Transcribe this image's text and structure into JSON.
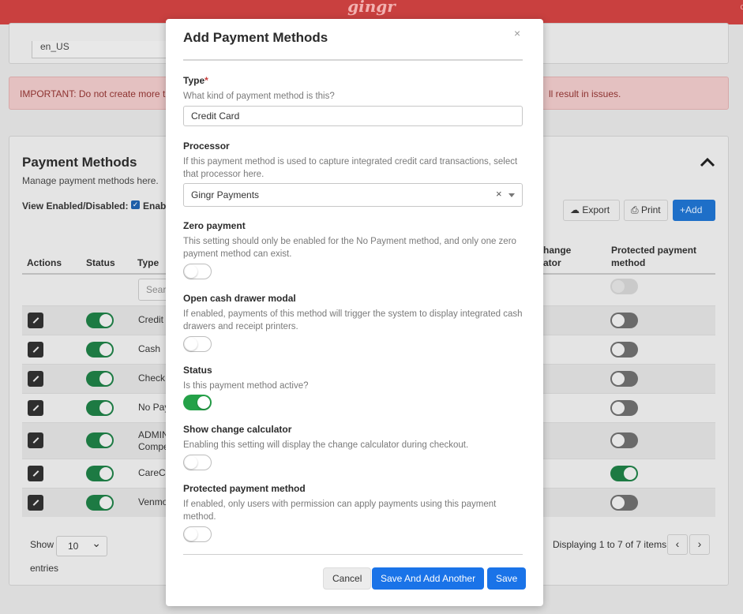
{
  "app": {
    "logo_text": "gingr"
  },
  "background": {
    "locale_value": "en_US",
    "alert_text_left": "IMPORTANT: Do not create more th",
    "alert_text_right": "ll result in issues.",
    "section_title": "Payment Methods",
    "section_subtitle": "Manage payment methods here.",
    "view_label": "View Enabled/Disabled:",
    "view_label_tail": "Enab",
    "toolbar": {
      "export_label": "Export",
      "print_label": "Print",
      "add_label": "Add"
    },
    "table": {
      "headers": {
        "actions": "Actions",
        "status": "Status",
        "type": "Type",
        "change_calc_1": "hange",
        "change_calc_2": "ator",
        "protected_1": "Protected payment",
        "protected_2": "method"
      },
      "search_placeholder": "Searc",
      "rows": [
        {
          "type": "Credit",
          "status_on": true,
          "protected_on": false
        },
        {
          "type": "Cash",
          "status_on": true,
          "protected_on": false
        },
        {
          "type": "Check",
          "status_on": true,
          "protected_on": false
        },
        {
          "type": "No Pay",
          "status_on": true,
          "protected_on": false
        },
        {
          "type_line1": "ADMIN",
          "type_line2": "Compe",
          "status_on": true,
          "protected_on": false
        },
        {
          "type": "CareCr",
          "status_on": true,
          "protected_on": true
        },
        {
          "type": "Venmo",
          "status_on": true,
          "protected_on": false
        }
      ]
    },
    "show_label": "Show",
    "page_size": "10",
    "entries_label": "entries",
    "displaying": "Displaying 1 to 7 of 7 items"
  },
  "modal": {
    "title": "Add Payment Methods",
    "close_glyph": "×",
    "type": {
      "label": "Type",
      "required_mark": "*",
      "help": "What kind of payment method is this?",
      "value": "Credit Card"
    },
    "processor": {
      "label": "Processor",
      "help": "If this payment method is used to capture integrated credit card transactions, select that processor here.",
      "value": "Gingr Payments",
      "clear_glyph": "×"
    },
    "zero_payment": {
      "label": "Zero payment",
      "help": "This setting should only be enabled for the No Payment method, and only one zero payment method can exist.",
      "enabled": false
    },
    "cash_drawer": {
      "label": "Open cash drawer modal",
      "help": "If enabled, payments of this method will trigger the system to display integrated cash drawers and receipt printers.",
      "enabled": false
    },
    "status": {
      "label": "Status",
      "help": "Is this payment method active?",
      "enabled": true
    },
    "change_calculator": {
      "label": "Show change calculator",
      "help": "Enabling this setting will display the change calculator during checkout.",
      "enabled": false
    },
    "protected": {
      "label": "Protected payment method",
      "help": "If enabled, only users with permission can apply payments using this payment method.",
      "enabled": false
    },
    "buttons": {
      "cancel": "Cancel",
      "save_add_another": "Save And Add Another",
      "save": "Save"
    }
  },
  "colors": {
    "brand": "#c9403f",
    "primary": "#1a73e8",
    "toggle_on": "#24a148"
  }
}
